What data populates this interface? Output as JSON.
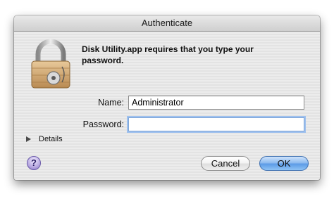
{
  "window": {
    "title": "Authenticate"
  },
  "message": "Disk Utility.app requires that you type your password.",
  "form": {
    "name_label": "Name:",
    "name_value": "Administrator",
    "password_label": "Password:",
    "password_value": ""
  },
  "details": {
    "label": "Details"
  },
  "help": {
    "glyph": "?"
  },
  "buttons": {
    "cancel_label": "Cancel",
    "ok_label": "OK"
  },
  "icons": {
    "lock": "padlock-icon",
    "details_toggle": "disclosure-triangle-icon",
    "help": "help-icon"
  }
}
